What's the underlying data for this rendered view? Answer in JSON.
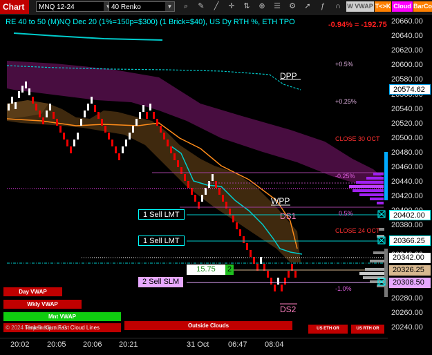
{
  "toolbar": {
    "chart_label": "Chart",
    "symbol": "MNQ 12-24",
    "bar_type": "40 Renko",
    "buttons": [
      "W VWAP",
      "T<>K",
      "Cloud",
      "BarCo"
    ]
  },
  "chart": {
    "title": "RE 40 to 50 (M)NQ Dec 20 (1%=150p=$300) (1 Brick=$40), US Dy RTH %, ETH TPO",
    "change": "-0.94% = -192.75"
  },
  "price_axis": {
    "ticks": [
      "20660.00",
      "20640.00",
      "20620.00",
      "20600.00",
      "20580.00",
      "20560.00",
      "20540.00",
      "20520.00",
      "20500.00",
      "20480.00",
      "20460.00",
      "20440.00",
      "20420.00",
      "20400.00",
      "20380.00",
      "20360.00",
      "20340.00",
      "20320.00",
      "20300.00",
      "20280.00",
      "20260.00",
      "20240.00"
    ],
    "tags": [
      {
        "text": "20574.62",
        "bg": "#ffffff",
        "fg": "#000000",
        "border": "#00b0ff"
      },
      {
        "text": "20402.00",
        "bg": "#ffffff",
        "fg": "#000000",
        "border": "#00ffff"
      },
      {
        "text": "20366.25",
        "bg": "#ffffff",
        "fg": "#000000",
        "border": "#00ffff"
      },
      {
        "text": "20342.00",
        "bg": "#ffffff",
        "fg": "#000000",
        "border": "#ffffff"
      },
      {
        "text": "20326.25",
        "bg": "#d8b890",
        "fg": "#000000",
        "border": "#d8b890"
      },
      {
        "text": "20308.50",
        "bg": "#e7a8ff",
        "fg": "#000000",
        "border": "#e7a8ff"
      }
    ]
  },
  "time_axis": {
    "ticks": [
      "20:02",
      "20:05",
      "20:06",
      "20:21",
      "31 Oct",
      "06:47",
      "08:04"
    ]
  },
  "labels": {
    "dpp": "DPP",
    "wpp": "WPP",
    "ds1": "DS1",
    "ds2": "DS2",
    "pct_05_top": "+0.5%",
    "pct_025_top": "+0.25%",
    "close30": "CLOSE 30 OCT",
    "pct_neg025": "-0.25%",
    "pct_05_mid": "0.5%",
    "close24": "CLOSE 24 OCT",
    "pct_neg1": "-1.0%"
  },
  "orders": [
    {
      "text": "1 Sell LMT",
      "bg": "#000000",
      "border": "#00ffff",
      "color": "#ffffff"
    },
    {
      "text": "1 Sell LMT",
      "bg": "#000000",
      "border": "#00ffff",
      "color": "#ffffff"
    },
    {
      "text": "2 Sell SLM",
      "bg": "#e7a8ff",
      "border": "#e7a8ff",
      "color": "#000000"
    }
  ],
  "entry": {
    "price": "15.75",
    "qty": "2"
  },
  "panel_buttons": {
    "day_vwap": "Day VWAP",
    "wkly_vwap": "Wkly VWAP",
    "mnt_vwap": "Mnt VWAP",
    "cloud_lines": "Tenkan Kijun Fast Cloud Lines",
    "copyright": "© 2024 NinjaTrader, LLC",
    "outside_clouds": "Outside Clouds",
    "us_eth": "US ETH OR",
    "us_rth": "US RTH OR"
  },
  "colors": {
    "accent_red": "#c00000",
    "cyan": "#00ffff",
    "purple_cloud": "#5a1050",
    "orange": "#ff8c1a",
    "green": "#00cc00"
  }
}
